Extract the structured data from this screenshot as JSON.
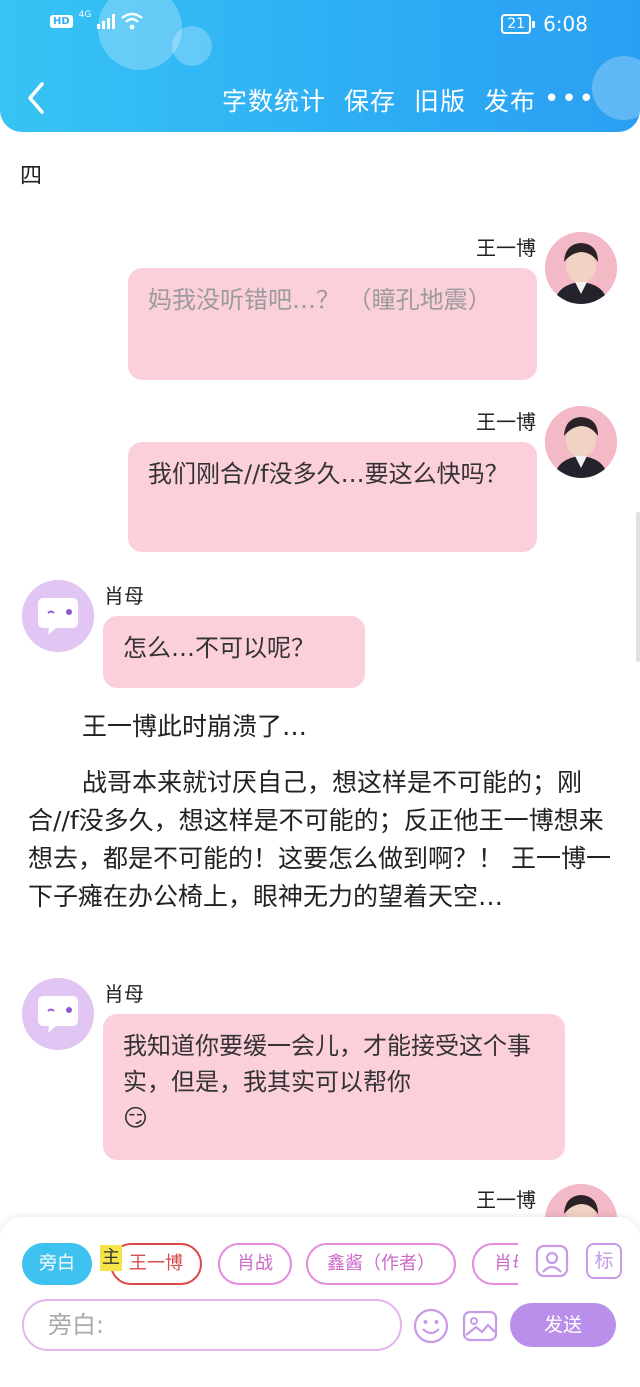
{
  "status_bar": {
    "network_badge": "HD",
    "network_type": "4G",
    "battery": "21",
    "time": "6:08"
  },
  "nav": {
    "actions": [
      "字数统计",
      "保存",
      "旧版",
      "发布"
    ],
    "more": "•••"
  },
  "chapter": "四",
  "messages": [
    {
      "speaker": "王一博",
      "text": "妈我没听错吧…？ （瞳孔地震）"
    },
    {
      "speaker": "王一博",
      "text": "我们刚合//f没多久…要这么快吗？"
    },
    {
      "speaker": "肖母",
      "text": "怎么…不可以呢？"
    },
    {
      "speaker": "肖母",
      "text": "我知道你要缓一会儿，才能接受这个事实，但是，我其实可以帮你"
    },
    {
      "speaker": "王一博"
    }
  ],
  "narration": [
    "王一博此时崩溃了…",
    "战哥本来就讨厌自己，想这样是不可能的；刚合//f没多久，想这样是不可能的；反正他王一博想来想去，都是不可能的！这要怎么做到啊？！ 王一博一下子瘫在办公椅上，眼神无力的望着天空…"
  ],
  "emoji": "😏",
  "composer": {
    "roles": [
      "旁白",
      "王一博",
      "肖战",
      "鑫酱（作者）",
      "肖母"
    ],
    "main_mark": "主",
    "tool_label": "标",
    "input_placeholder": "旁白:",
    "send_label": "发送"
  },
  "colors": {
    "header": "#2eaef5",
    "bubble": "#fcd0db",
    "accent_purple": "#b98fea"
  }
}
